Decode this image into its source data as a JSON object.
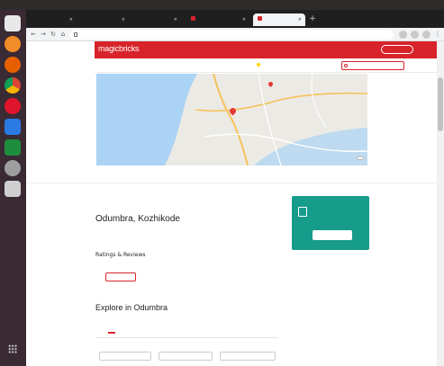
{
  "os_bar": {
    "left": "",
    "clock": "",
    "right": ""
  },
  "dock_icons": [
    {
      "name": "files-icon",
      "color": "#e8e8e8"
    },
    {
      "name": "cpanel-icon",
      "color": "#f28c28"
    },
    {
      "name": "firefox-icon",
      "color": "#e66000"
    },
    {
      "name": "chrome-icon",
      "color": "#4285f4"
    },
    {
      "name": "opera-icon",
      "color": "#e0142b"
    },
    {
      "name": "docs-icon",
      "color": "#2a7ae2"
    },
    {
      "name": "sheets-icon",
      "color": "#1e8e3e"
    },
    {
      "name": "settings-icon",
      "color": "#9e9e9e"
    },
    {
      "name": "drive-icon",
      "color": "#cfcfcf"
    }
  ],
  "browser": {
    "tabs": [
      {
        "title": "",
        "active": false
      },
      {
        "title": "",
        "active": false
      },
      {
        "title": "",
        "active": false
      },
      {
        "title": "",
        "active": false
      },
      {
        "title": "",
        "active": true
      }
    ],
    "url": ""
  },
  "site": {
    "logo": "magicbricks",
    "login": "",
    "post_property": "",
    "post_badge": "",
    "nav": [
      {
        "label": ""
      },
      {
        "label": ""
      },
      {
        "label": ""
      },
      {
        "label": ""
      },
      {
        "label": ""
      },
      {
        "label": "",
        "badge": ""
      },
      {
        "label": ""
      }
    ],
    "search_placeholder": ""
  },
  "map": {
    "labels": [
      "",
      "",
      "",
      ""
    ],
    "view_map": "",
    "water_color": "#aad3f5",
    "land_color": "#eceae4",
    "road_color": "#f6c25b",
    "pin_color": "#e53935"
  },
  "locality_tabs": [
    "",
    "",
    "",
    "",
    "",
    "",
    "",
    "",
    "",
    ""
  ],
  "breadcrumb": "",
  "locality": {
    "title": "Odumbra, Kozhikode",
    "subtitle": "",
    "rating": "",
    "rating_stars": "",
    "rating_link": ""
  },
  "cta": {
    "text": "",
    "button": ""
  },
  "ratings_section": {
    "heading": "Ratings & Reviews",
    "button": ""
  },
  "explore": {
    "heading": "Explore in Odumbra",
    "tabs": [
      {
        "label": "",
        "active": true
      },
      {
        "label": "",
        "active": false
      }
    ],
    "links": [
      "",
      "",
      ""
    ]
  },
  "colors": {
    "brand": "#d8232a",
    "cta": "#179b8b"
  }
}
